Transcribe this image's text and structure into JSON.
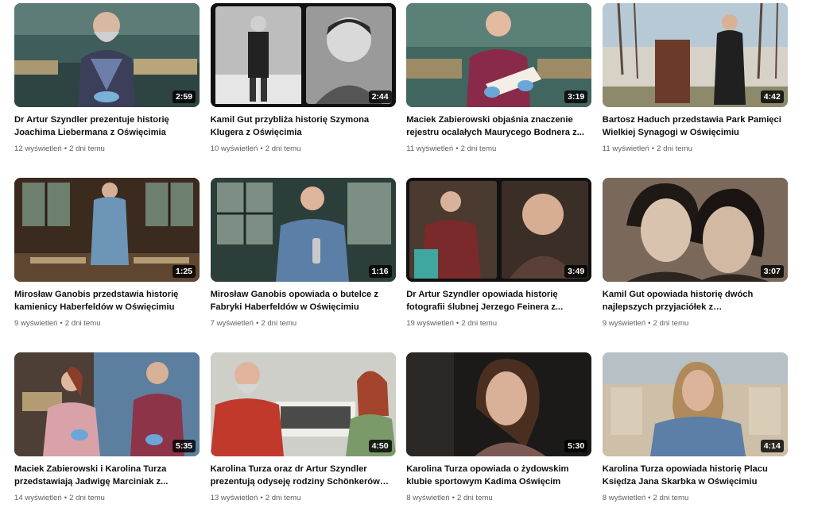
{
  "videos": [
    {
      "title": "Dr Artur Szyndler prezentuje historię Joachima Liebermana z Oświęcimia",
      "duration": "2:59",
      "views": "12 wyświetleń",
      "age": "2 dni temu"
    },
    {
      "title": "Kamil Gut przybliża historię Szymona Klugera z Oświęcimia",
      "duration": "2:44",
      "views": "10 wyświetleń",
      "age": "2 dni temu"
    },
    {
      "title": "Maciek Zabierowski objaśnia znaczenie rejestru ocalałych Maurycego Bodnera z...",
      "duration": "3:19",
      "views": "11 wyświetleń",
      "age": "2 dni temu"
    },
    {
      "title": "Bartosz Haduch przedstawia Park Pamięci Wielkiej Synagogi w Oświęcimiu",
      "duration": "4:42",
      "views": "11 wyświetleń",
      "age": "2 dni temu"
    },
    {
      "title": "Mirosław Ganobis przedstawia historię kamienicy Haberfeldów w Oświęcimiu",
      "duration": "1:25",
      "views": "9 wyświetleń",
      "age": "2 dni temu"
    },
    {
      "title": "Mirosław Ganobis opowiada o butelce z Fabryki Haberfeldów w Oświęcimiu",
      "duration": "1:16",
      "views": "7 wyświetleń",
      "age": "2 dni temu"
    },
    {
      "title": "Dr Artur Szyndler opowiada historię fotografii ślubnej Jerzego Feinera z...",
      "duration": "3:49",
      "views": "19 wyświetleń",
      "age": "2 dni temu"
    },
    {
      "title": "Kamil Gut opowiada historię dwóch najlepszych przyjaciółek z przedwojennego...",
      "duration": "3:07",
      "views": "9 wyświetleń",
      "age": "2 dni temu"
    },
    {
      "title": "Maciek Zabierowski i Karolina Turza przedstawiają Jadwigę Marciniak z...",
      "duration": "5:35",
      "views": "14 wyświetleń",
      "age": "2 dni temu"
    },
    {
      "title": "Karolina Turza oraz dr Artur Szyndler prezentują odyseję rodziny Schönkerów z...",
      "duration": "4:50",
      "views": "13 wyświetleń",
      "age": "2 dni temu"
    },
    {
      "title": "Karolina Turza opowiada o żydowskim klubie sportowym Kadima Oświęcim",
      "duration": "5:30",
      "views": "8 wyświetleń",
      "age": "2 dni temu"
    },
    {
      "title": "Karolina Turza opowiada historię Placu Księdza Jana Skarbka w Oświęcimiu",
      "duration": "4:14",
      "views": "8 wyświetleń",
      "age": "2 dni temu"
    }
  ],
  "separator": "•"
}
